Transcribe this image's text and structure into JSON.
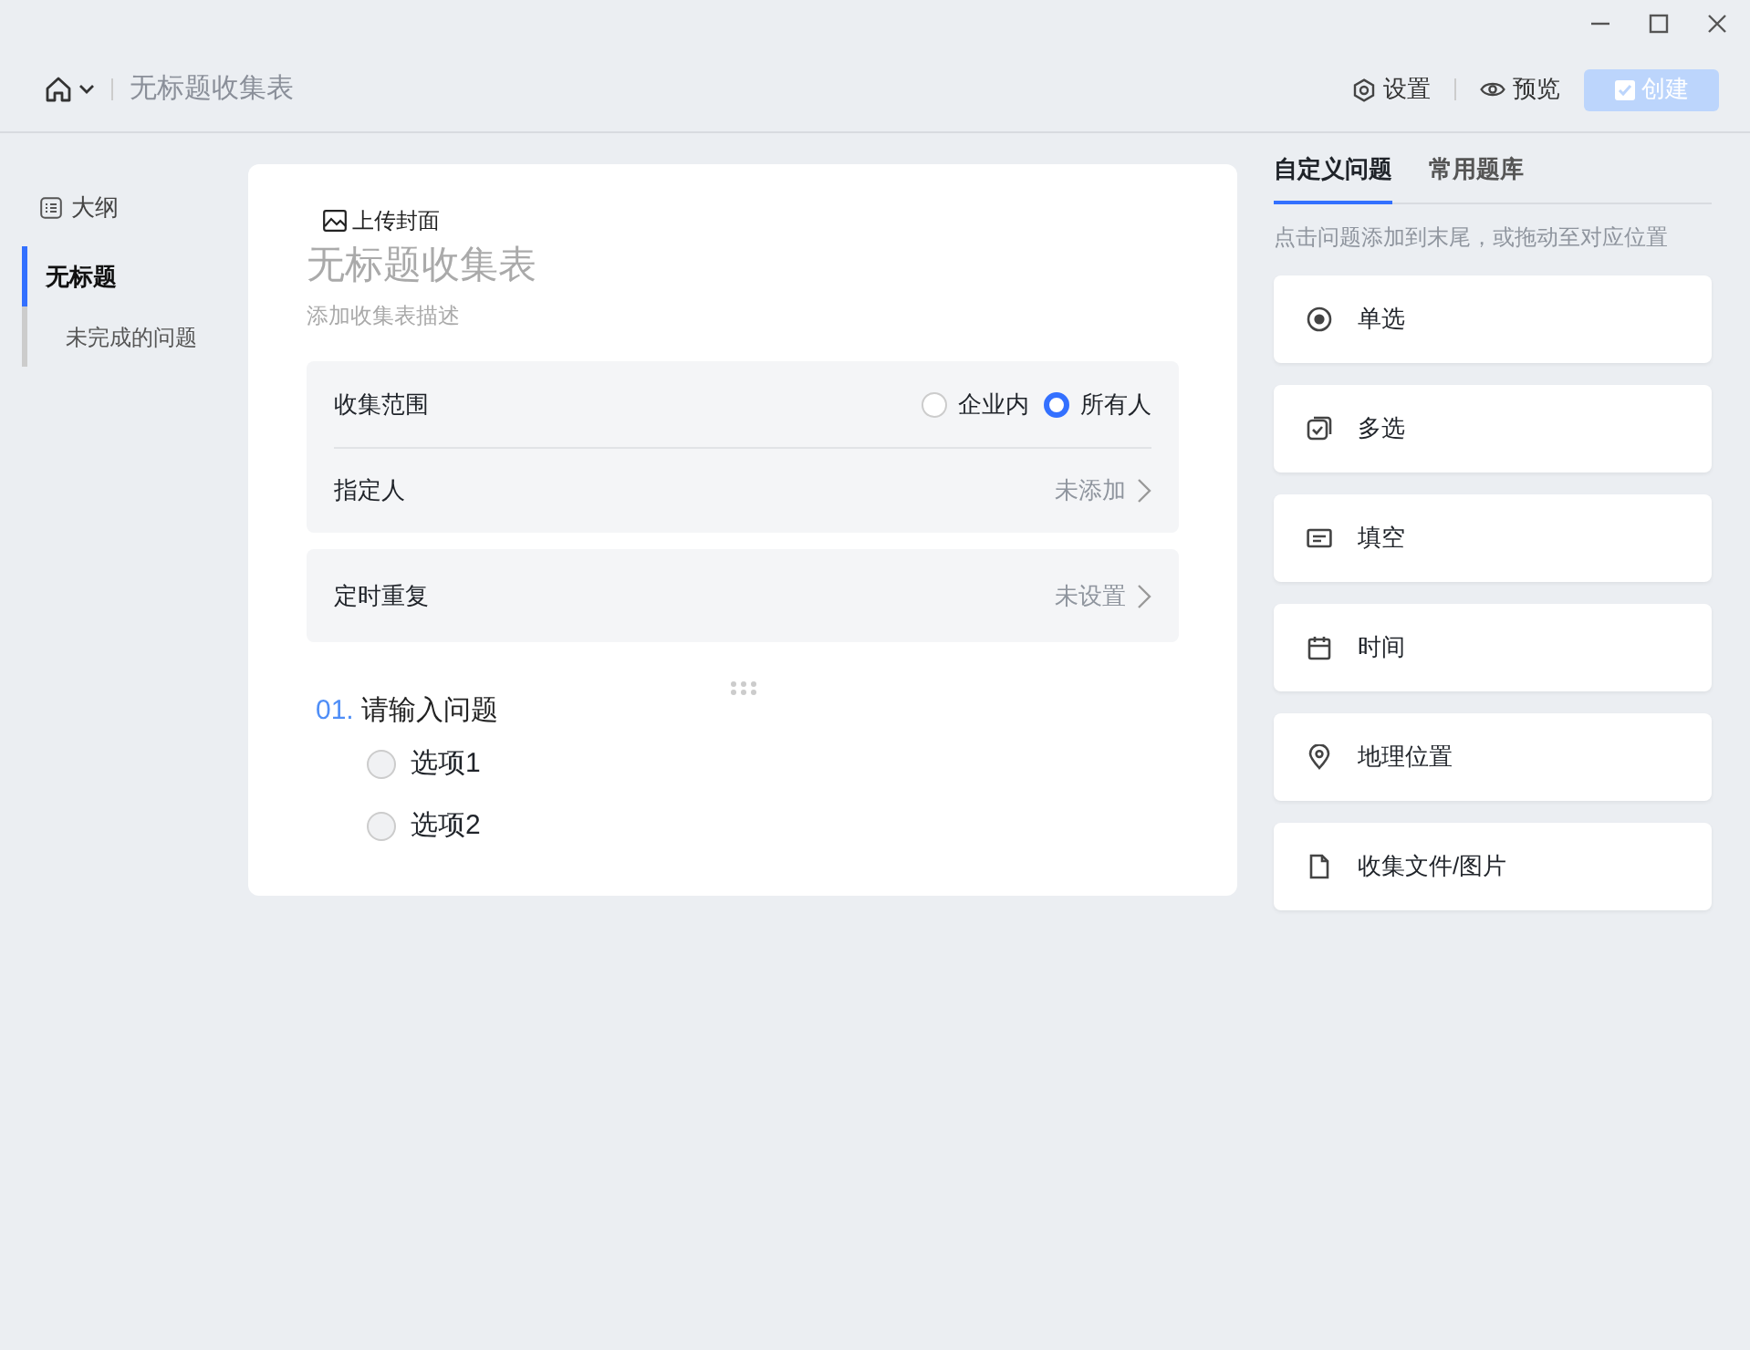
{
  "header": {
    "title": "无标题收集表",
    "actions": [
      {
        "kind": "settings",
        "label": "设置"
      },
      {
        "kind": "preview",
        "label": "预览"
      }
    ],
    "create_button": {
      "label": "创建",
      "disabled": true
    }
  },
  "sidebar": {
    "heading": "大纲",
    "items": [
      {
        "label": "无标题",
        "selected": true,
        "children": [
          {
            "label": "未完成的问题",
            "selected": false
          }
        ]
      }
    ]
  },
  "form": {
    "upload_cover": "上传封面",
    "title_placeholder": "无标题收集表",
    "description_placeholder": "添加收集表描述",
    "scope": {
      "label": "收集范围",
      "options": [
        {
          "label": "企业内",
          "selected": false
        },
        {
          "label": "所有人",
          "selected": true
        }
      ]
    },
    "assignee": {
      "label": "指定人",
      "value": "未添加"
    },
    "repeat": {
      "label": "定时重复",
      "value": "未设置"
    },
    "question": {
      "number": "01.",
      "placeholder": "请输入问题",
      "options": [
        {
          "label": "选项1",
          "selected": false
        },
        {
          "label": "选项2",
          "selected": false
        }
      ]
    }
  },
  "panel": {
    "tabs": [
      {
        "label": "自定义问题",
        "selected": true
      },
      {
        "label": "常用题库",
        "selected": false
      }
    ],
    "hint": "点击问题添加到末尾，或拖动至对应位置",
    "question_types": [
      {
        "kind": "single",
        "label": "单选"
      },
      {
        "kind": "multiple",
        "label": "多选"
      },
      {
        "kind": "text",
        "label": "填空"
      },
      {
        "kind": "date",
        "label": "时间"
      },
      {
        "kind": "location",
        "label": "地理位置"
      },
      {
        "kind": "file",
        "label": "收集文件/图片"
      }
    ]
  }
}
